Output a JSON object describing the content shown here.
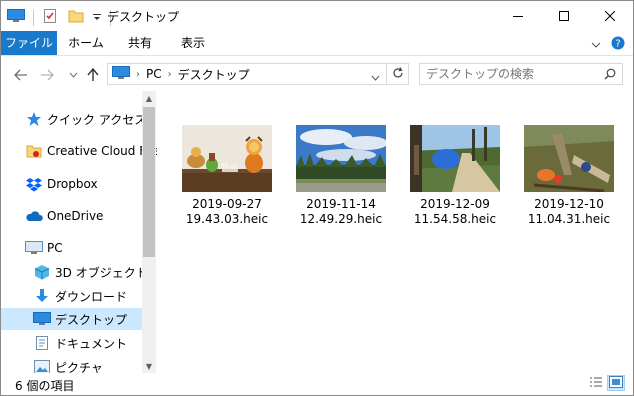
{
  "window": {
    "title": "デスクトップ"
  },
  "ribbon": {
    "tabs": [
      "ファイル",
      "ホーム",
      "共有",
      "表示"
    ]
  },
  "address": {
    "crumbs": [
      "PC",
      "デスクトップ"
    ]
  },
  "search": {
    "placeholder": "デスクトップの検索"
  },
  "nav": {
    "items": [
      {
        "label": "クイック アクセス",
        "icon": "star-icon"
      },
      {
        "label": "Creative Cloud Files",
        "icon": "creative-cloud-folder-icon"
      },
      {
        "label": "Dropbox",
        "icon": "dropbox-icon"
      },
      {
        "label": "OneDrive",
        "icon": "onedrive-cloud-icon"
      },
      {
        "label": "PC",
        "icon": "pc-icon"
      },
      {
        "label": "3D オブジェクト",
        "icon": "3d-objects-icon"
      },
      {
        "label": "ダウンロード",
        "icon": "download-icon"
      },
      {
        "label": "デスクトップ",
        "icon": "desktop-icon"
      },
      {
        "label": "ドキュメント",
        "icon": "documents-icon"
      },
      {
        "label": "ピクチャ",
        "icon": "pictures-icon"
      }
    ]
  },
  "files": [
    {
      "line1": "2019-09-27",
      "line2": "19.43.03.heic"
    },
    {
      "line1": "2019-11-14",
      "line2": "12.49.29.heic"
    },
    {
      "line1": "2019-12-09",
      "line2": "11.54.58.heic"
    },
    {
      "line1": "2019-12-10",
      "line2": "11.04.31.heic"
    }
  ],
  "status": {
    "count": "6 個の項目"
  },
  "colors": {
    "accent": "#1979ca",
    "selected": "#cce8ff"
  }
}
